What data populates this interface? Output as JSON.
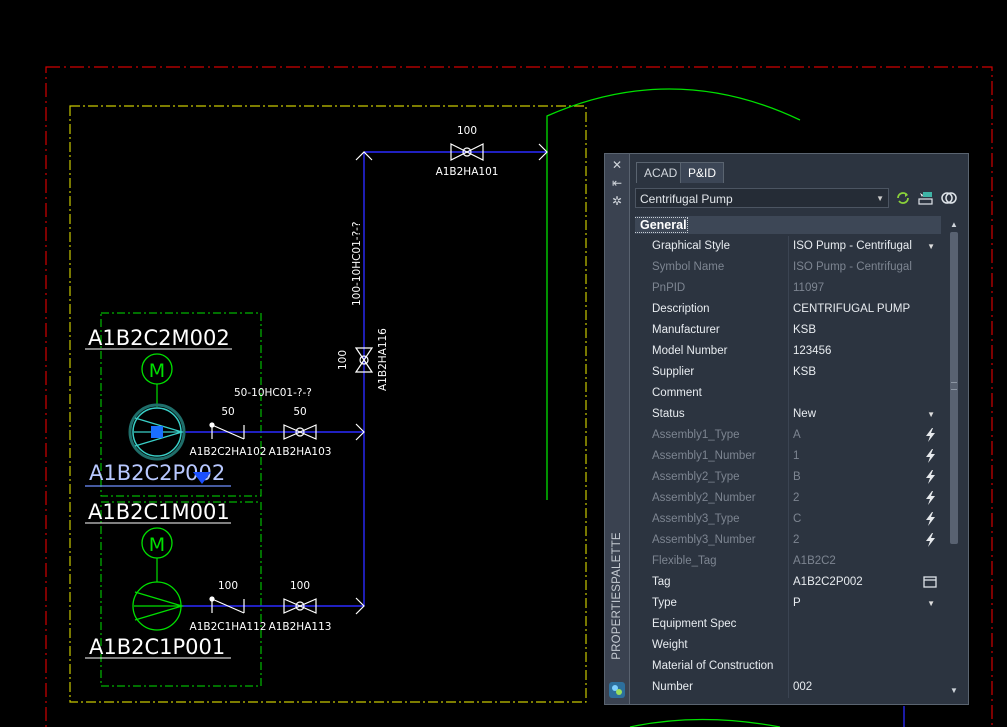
{
  "drawing": {
    "equipment_tags": {
      "motor_top": "A1B2C2M002",
      "pump_top": "A1B2C2P002",
      "motor_bottom": "A1B2C1M001",
      "pump_bottom": "A1B2C1P001"
    },
    "motor_symbol": "M",
    "line_tags": {
      "upper": "50-10HC01-?-?",
      "vertical": "100-10HC01-?-?"
    },
    "valves": {
      "check_top": {
        "size": "50",
        "tag": "A1B2C2HA102"
      },
      "gate_top": {
        "size": "50",
        "tag": "A1B2HA103"
      },
      "check_bottom": {
        "size": "100",
        "tag": "A1B2C1HA112"
      },
      "gate_bottom": {
        "size": "100",
        "tag": "A1B2HA113"
      },
      "vertical": {
        "size": "100",
        "tag": "A1B2HA116"
      },
      "top": {
        "size": "100",
        "tag": "A1B2HA101"
      }
    },
    "colors": {
      "pipe": "#2a2aff",
      "equipment": "#00e000",
      "selected": "#39d0c8",
      "border_red": "#d00000",
      "border_yellow": "#c8c800"
    }
  },
  "palette": {
    "title": "PROPERTIESPALETTE",
    "tabs": [
      "ACAD",
      "P&ID"
    ],
    "active_tab": "P&ID",
    "object_type": "Centrifugal Pump",
    "section": "General",
    "properties": [
      {
        "name": "Graphical Style",
        "value": "ISO Pump - Centrifugal",
        "state": "active",
        "control": "dropdown"
      },
      {
        "name": "Symbol Name",
        "value": "ISO Pump - Centrifugal",
        "state": "disabled",
        "control": "none"
      },
      {
        "name": "PnPID",
        "value": "11097",
        "state": "disabled",
        "control": "none"
      },
      {
        "name": "Description",
        "value": "CENTRIFUGAL PUMP",
        "state": "active",
        "control": "none"
      },
      {
        "name": "Manufacturer",
        "value": "KSB",
        "state": "active",
        "control": "none"
      },
      {
        "name": "Model Number",
        "value": "123456",
        "state": "active",
        "control": "none"
      },
      {
        "name": "Supplier",
        "value": "KSB",
        "state": "active",
        "control": "none"
      },
      {
        "name": "Comment",
        "value": "",
        "state": "active",
        "control": "none"
      },
      {
        "name": "Status",
        "value": "New",
        "state": "active",
        "control": "dropdown"
      },
      {
        "name": "Assembly1_Type",
        "value": "A",
        "state": "disabled",
        "control": "lightning"
      },
      {
        "name": "Assembly1_Number",
        "value": "1",
        "state": "disabled",
        "control": "lightning"
      },
      {
        "name": "Assembly2_Type",
        "value": "B",
        "state": "disabled",
        "control": "lightning"
      },
      {
        "name": "Assembly2_Number",
        "value": "2",
        "state": "disabled",
        "control": "lightning"
      },
      {
        "name": "Assembly3_Type",
        "value": "C",
        "state": "disabled",
        "control": "lightning"
      },
      {
        "name": "Assembly3_Number",
        "value": "2",
        "state": "disabled",
        "control": "lightning"
      },
      {
        "name": "Flexible_Tag",
        "value": "A1B2C2",
        "state": "disabled",
        "control": "none"
      },
      {
        "name": "Tag",
        "value": "A1B2C2P002",
        "state": "active",
        "control": "tag-button"
      },
      {
        "name": "Type",
        "value": "P",
        "state": "active",
        "control": "dropdown"
      },
      {
        "name": "Equipment Spec",
        "value": "",
        "state": "active",
        "control": "none"
      },
      {
        "name": "Weight",
        "value": "",
        "state": "active",
        "control": "none"
      },
      {
        "name": "Material of Construction",
        "value": "",
        "state": "active",
        "control": "none"
      },
      {
        "name": "Number",
        "value": "002",
        "state": "active",
        "control": "none"
      }
    ]
  }
}
